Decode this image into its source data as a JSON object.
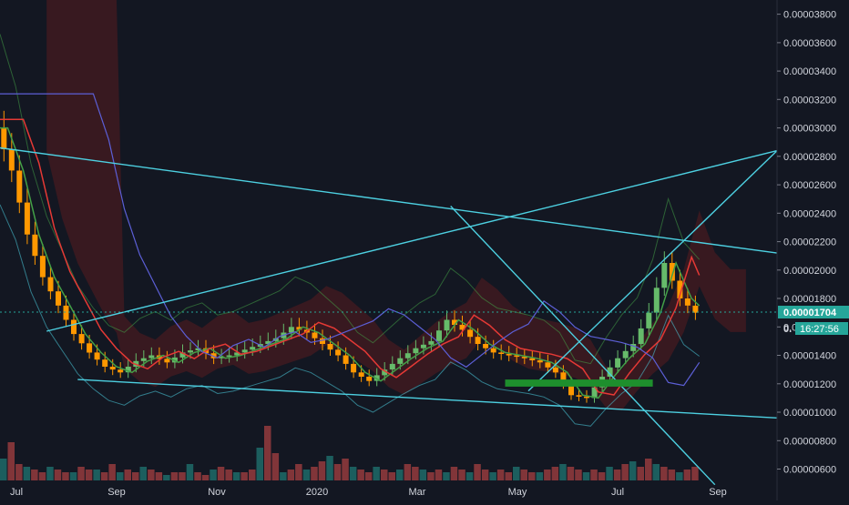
{
  "chart_data": {
    "type": "candlestick",
    "title": "",
    "x_labels": [
      "Jul",
      "Sep",
      "Nov",
      "2020",
      "Mar",
      "May",
      "Jul",
      "Sep"
    ],
    "y_ticks": [
      "0.00003800",
      "0.00003600",
      "0.00003400",
      "0.00003200",
      "0.00003000",
      "0.00002800",
      "0.00002600",
      "0.00002400",
      "0.00002200",
      "0.00002000",
      "0.00001800",
      "0.00001600",
      "0.00001400",
      "0.00001200",
      "0.00001000",
      "0.00000800",
      "0.00000600"
    ],
    "ylim": [
      5.2e-06,
      3.9e-05
    ],
    "grid": false,
    "current_price": 1.704e-05,
    "current_price_label": "0.00001704",
    "countdown_label": "16:27:56",
    "countdown_prefix": "0.",
    "price_series": [
      {
        "x": 0,
        "y": 3e-05
      },
      {
        "x": 2,
        "y": 2.7e-05
      },
      {
        "x": 4,
        "y": 2.25e-05
      },
      {
        "x": 6,
        "y": 1.95e-05
      },
      {
        "x": 8,
        "y": 1.75e-05
      },
      {
        "x": 10,
        "y": 1.55e-05
      },
      {
        "x": 12,
        "y": 1.42e-05
      },
      {
        "x": 14,
        "y": 1.32e-05
      },
      {
        "x": 16,
        "y": 1.28e-05
      },
      {
        "x": 18,
        "y": 1.36e-05
      },
      {
        "x": 20,
        "y": 1.4e-05
      },
      {
        "x": 22,
        "y": 1.35e-05
      },
      {
        "x": 24,
        "y": 1.42e-05
      },
      {
        "x": 26,
        "y": 1.45e-05
      },
      {
        "x": 28,
        "y": 1.38e-05
      },
      {
        "x": 30,
        "y": 1.4e-05
      },
      {
        "x": 32,
        "y": 1.44e-05
      },
      {
        "x": 34,
        "y": 1.48e-05
      },
      {
        "x": 36,
        "y": 1.52e-05
      },
      {
        "x": 38,
        "y": 1.6e-05
      },
      {
        "x": 40,
        "y": 1.56e-05
      },
      {
        "x": 42,
        "y": 1.48e-05
      },
      {
        "x": 44,
        "y": 1.4e-05
      },
      {
        "x": 46,
        "y": 1.28e-05
      },
      {
        "x": 48,
        "y": 1.22e-05
      },
      {
        "x": 50,
        "y": 1.3e-05
      },
      {
        "x": 52,
        "y": 1.38e-05
      },
      {
        "x": 54,
        "y": 1.45e-05
      },
      {
        "x": 56,
        "y": 1.5e-05
      },
      {
        "x": 58,
        "y": 1.65e-05
      },
      {
        "x": 60,
        "y": 1.58e-05
      },
      {
        "x": 62,
        "y": 1.48e-05
      },
      {
        "x": 64,
        "y": 1.42e-05
      },
      {
        "x": 66,
        "y": 1.4e-05
      },
      {
        "x": 68,
        "y": 1.38e-05
      },
      {
        "x": 70,
        "y": 1.35e-05
      },
      {
        "x": 72,
        "y": 1.28e-05
      },
      {
        "x": 74,
        "y": 1.12e-05
      },
      {
        "x": 76,
        "y": 1.1e-05
      },
      {
        "x": 78,
        "y": 1.25e-05
      },
      {
        "x": 80,
        "y": 1.38e-05
      },
      {
        "x": 82,
        "y": 1.48e-05
      },
      {
        "x": 84,
        "y": 1.7e-05
      },
      {
        "x": 86,
        "y": 2.05e-05
      },
      {
        "x": 88,
        "y": 1.8e-05
      },
      {
        "x": 90,
        "y": 1.7e-05
      }
    ],
    "volume": [
      8,
      14,
      6,
      5,
      4,
      3,
      5,
      4,
      3,
      3,
      5,
      4,
      4,
      3,
      6,
      3,
      4,
      3,
      5,
      4,
      3,
      2,
      3,
      3,
      6,
      3,
      2,
      4,
      5,
      4,
      3,
      3,
      4,
      12,
      20,
      10,
      3,
      4,
      6,
      4,
      5,
      7,
      9,
      6,
      8,
      5,
      4,
      3,
      5,
      4,
      3,
      4,
      6,
      5,
      4,
      3,
      4,
      3,
      5,
      4,
      3,
      6,
      4,
      3,
      4,
      3,
      5,
      4,
      3,
      3,
      4,
      5,
      6,
      5,
      4,
      3,
      4,
      3,
      5,
      4,
      6,
      7,
      5,
      8,
      6,
      5,
      4,
      3,
      4,
      5
    ],
    "trendlines": [
      {
        "name": "upper-channel",
        "x1": 0,
        "y1": 2.86e-05,
        "x2": 100,
        "y2": 2.12e-05
      },
      {
        "name": "lower-channel",
        "x1": 10,
        "y1": 1.23e-05,
        "x2": 100,
        "y2": 9.6e-06
      },
      {
        "name": "rising-line",
        "x1": 6,
        "y1": 1.57e-05,
        "x2": 100,
        "y2": 2.84e-05
      },
      {
        "name": "descending-diag",
        "x1": 58,
        "y1": 2.45e-05,
        "x2": 92,
        "y2": 4.9e-06
      },
      {
        "name": "steep-rise",
        "x1": 68,
        "y1": 1.15e-05,
        "x2": 100,
        "y2": 2.84e-05
      }
    ],
    "support_zone": {
      "x1": 65,
      "x2": 84,
      "y_low": 1.18e-05,
      "y_high": 1.23e-05
    },
    "colors": {
      "background": "#131722",
      "axis_text": "#d1d4dc",
      "up": "#26a69a",
      "down": "#ef5350",
      "candle_up": "#66bb6a",
      "candle_down": "#ff9800",
      "trendline": "#4dd0e1",
      "cloud_red": "#7f1d1d",
      "cloud_green": "#1b5e20",
      "ma_red": "#e53935",
      "ma_green": "#43a047",
      "ma_purple": "#5c5fd6",
      "price_tag": "#26a69a",
      "support_zone": "#1e8f2d"
    }
  }
}
